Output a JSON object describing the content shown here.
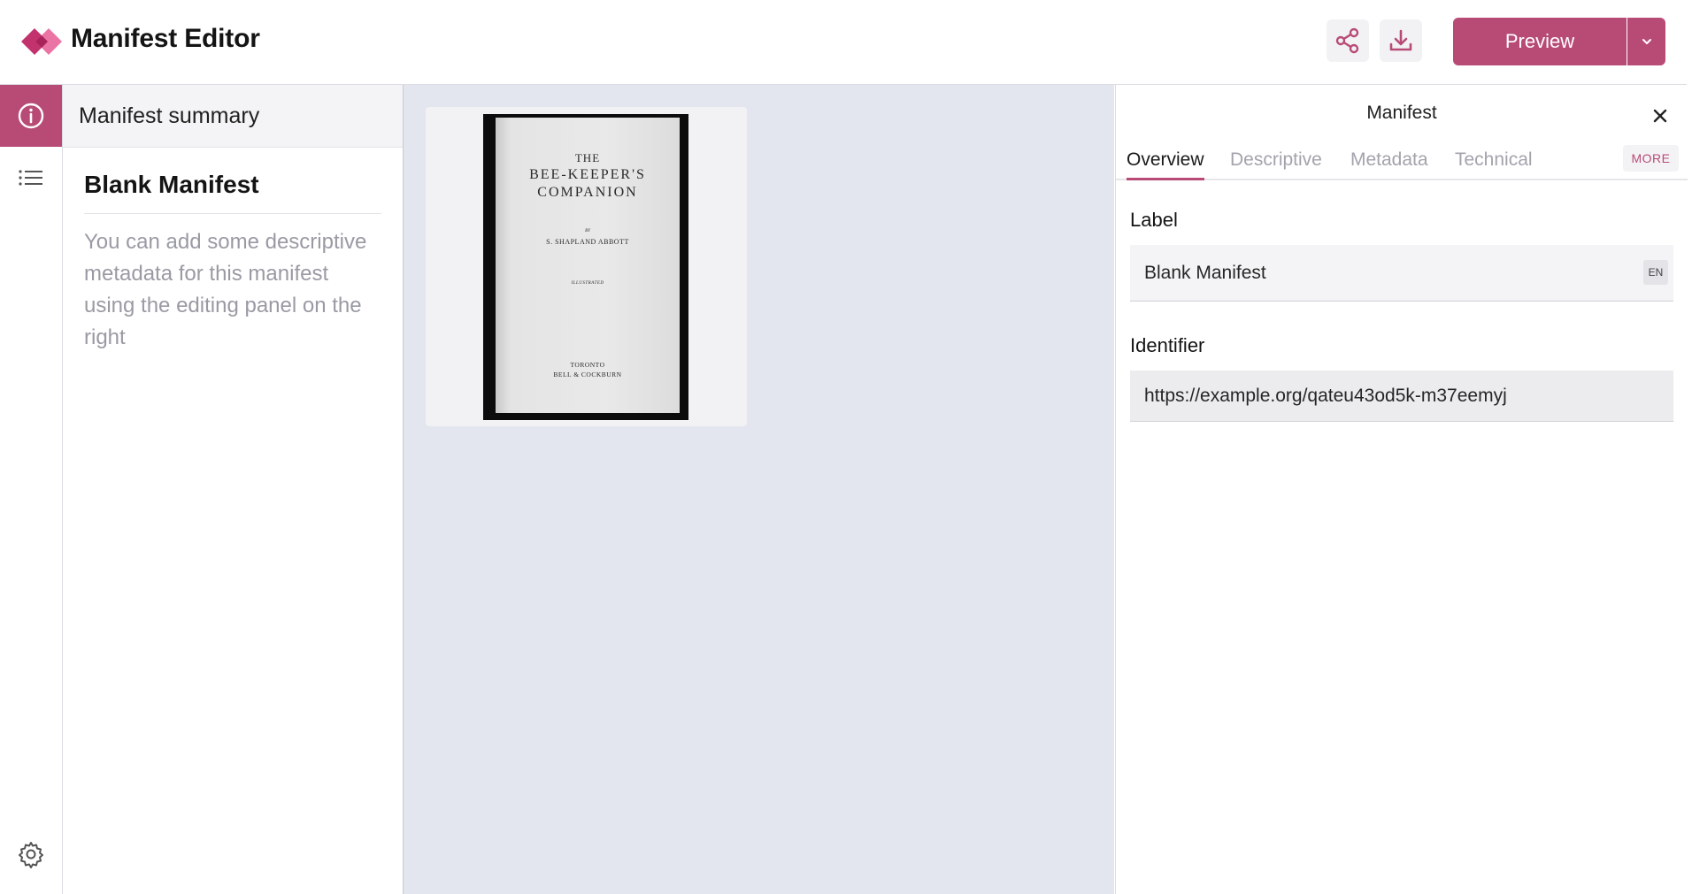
{
  "header": {
    "app_title": "Manifest Editor",
    "share_icon": "share-icon",
    "download_icon": "download-icon",
    "preview_label": "Preview",
    "dropdown_icon": "chevron-down-icon"
  },
  "colors": {
    "accent": "#b84b76",
    "logo_dark": "#c2326d",
    "logo_light": "#e8669a",
    "canvas_bg": "#e4e6ef"
  },
  "rail": {
    "items": [
      {
        "icon": "info-icon",
        "active": true
      },
      {
        "icon": "list-icon",
        "active": false
      }
    ],
    "settings_icon": "gear-icon"
  },
  "left_panel": {
    "header": "Manifest summary",
    "title": "Blank Manifest",
    "description": "You can add some descriptive metadata for this manifest using the editing panel on the right"
  },
  "canvas": {
    "book_cover": {
      "line1": "THE",
      "line2": "BEE-KEEPER'S",
      "line3": "COMPANION",
      "by": "BY",
      "author": "S. SHAPLAND ABBOTT",
      "illustrated": "ILLUSTRATED",
      "pub_place": "TORONTO",
      "publisher": "BELL & COCKBURN"
    }
  },
  "right_panel": {
    "title": "Manifest",
    "close_icon": "close-icon",
    "tabs": [
      {
        "label": "Overview",
        "active": true
      },
      {
        "label": "Descriptive",
        "active": false
      },
      {
        "label": "Metadata",
        "active": false
      },
      {
        "label": "Technical",
        "active": false
      }
    ],
    "more_label": "MORE",
    "fields": {
      "label_title": "Label",
      "label_value": "Blank Manifest",
      "label_lang": "EN",
      "identifier_title": "Identifier",
      "identifier_value": "https://example.org/qateu43od5k-m37eemyj"
    }
  }
}
